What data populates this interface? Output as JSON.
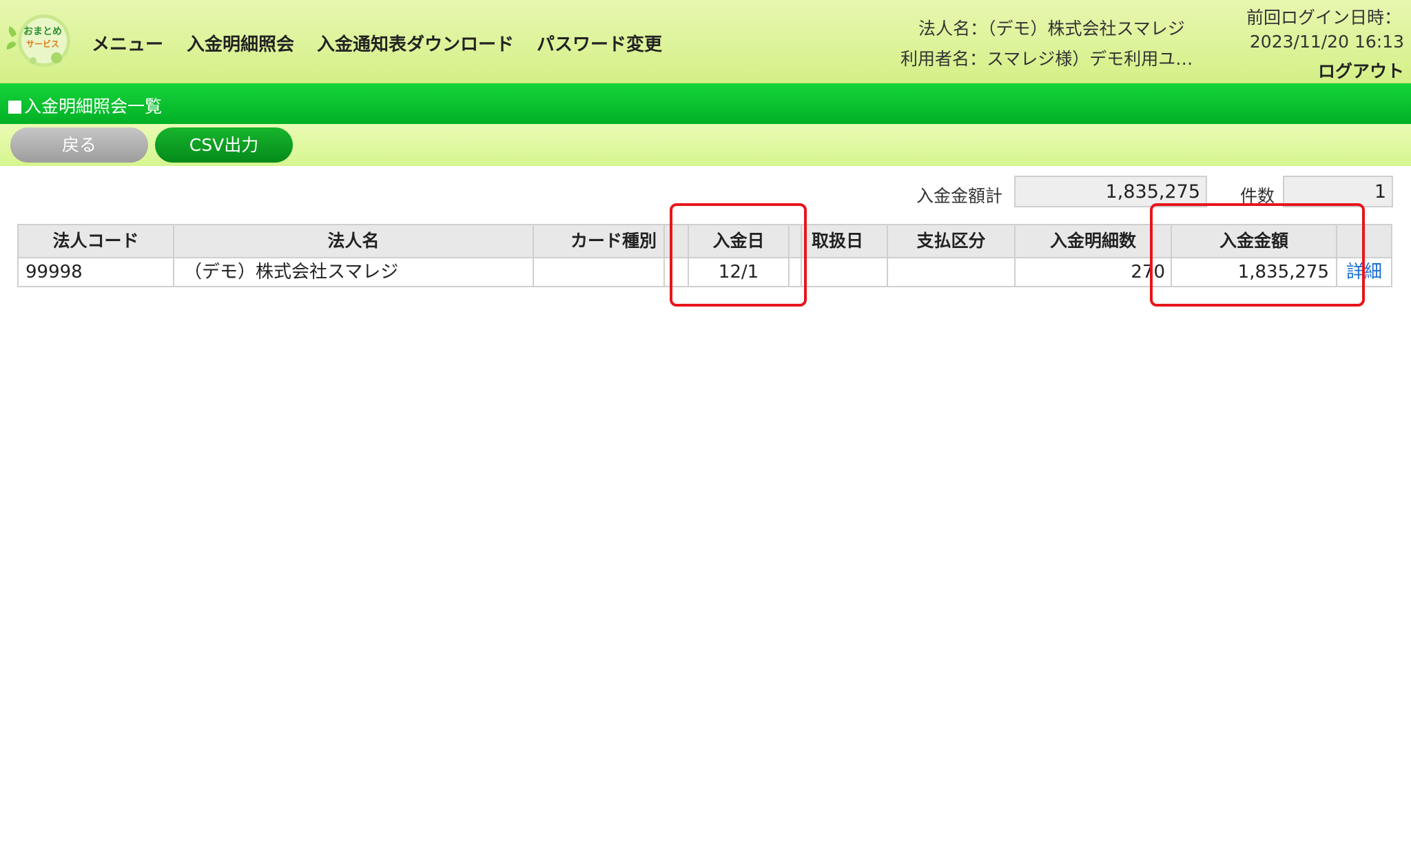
{
  "header": {
    "logo_text": "おまとめサービス",
    "nav": [
      "メニュー",
      "入金明細照会",
      "入金通知表ダウンロード",
      "パスワード変更"
    ],
    "company_label": "法人名：（デモ）株式会社スマレジ",
    "user_label": "利用者名：スマレジ様）デモ利用ユ…",
    "last_login_label": "前回ログイン日時：",
    "last_login_value": "2023/11/20 16:13",
    "logout": "ログアウト"
  },
  "page": {
    "title": "入金明細照会一覧"
  },
  "toolbar": {
    "back_label": "戻る",
    "csv_label": "CSV出力"
  },
  "totals": {
    "amount_label": "入金金額計",
    "amount_value": "1,835,275",
    "count_label": "件数",
    "count_value": "1"
  },
  "table": {
    "headers": [
      "法人コード",
      "法人名",
      "カード種別",
      "",
      "入金日",
      "",
      "取扱日",
      "支払区分",
      "入金明細数",
      "入金金額",
      ""
    ],
    "rows": [
      {
        "corp_code": "99998",
        "corp_name": "（デモ）株式会社スマレジ",
        "card_type": "",
        "deposit_date": "12/1",
        "handling_date": "",
        "payment_type": "",
        "detail_count": "270",
        "amount": "1,835,275",
        "detail_link": "詳細"
      }
    ]
  },
  "colors": {
    "header_bg": "#dff5a0",
    "title_bar": "#06c22c",
    "csv_button": "#0c9e22",
    "back_button": "#b0b0b0",
    "highlight": "#e8141b",
    "link": "#1a6fd6"
  }
}
